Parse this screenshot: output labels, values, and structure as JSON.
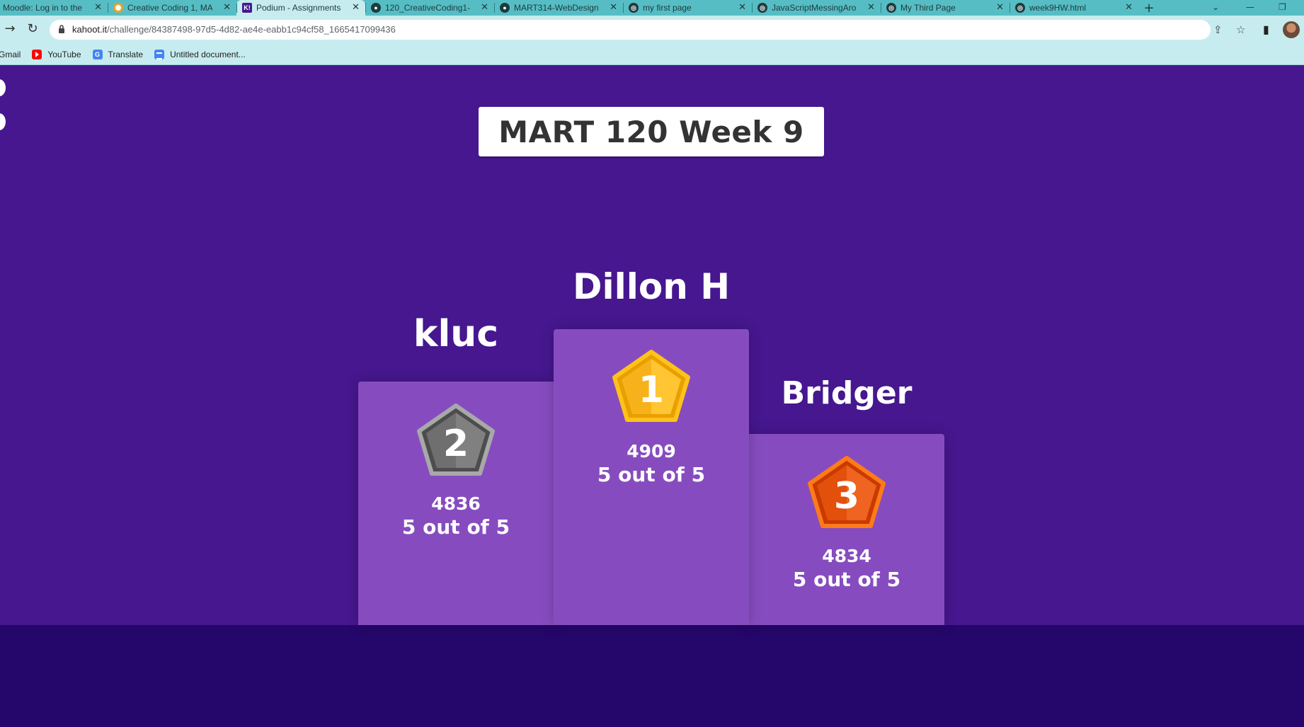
{
  "browser": {
    "tabs": [
      {
        "label": "Moodle: Log in to the",
        "active": false
      },
      {
        "label": "Creative Coding 1, MA",
        "active": false
      },
      {
        "label": "Podium - Assignments",
        "active": true
      },
      {
        "label": "120_CreativeCoding1-",
        "active": false
      },
      {
        "label": "MART314-WebDesign",
        "active": false
      },
      {
        "label": "my first page",
        "active": false
      },
      {
        "label": "JavaScriptMessingAro",
        "active": false
      },
      {
        "label": "My Third Page",
        "active": false
      },
      {
        "label": "week9HW.html",
        "active": false
      }
    ],
    "url_host": "kahoot.it",
    "url_path": "/challenge/84387498-97d5-4d82-ae4e-eabb1c94cf58_1665417099436",
    "bookmarks": [
      {
        "label": "Gmail",
        "icon": "gmail-icon"
      },
      {
        "label": "YouTube",
        "icon": "youtube-icon"
      },
      {
        "label": "Translate",
        "icon": "translate-icon"
      },
      {
        "label": "Untitled document...",
        "icon": "docs-icon"
      }
    ]
  },
  "kahoot": {
    "title": "MART 120 Week 9",
    "colors": {
      "background": "#46178f",
      "footer": "#25076b",
      "pillar": "#864cbf"
    },
    "podium": [
      {
        "rank": "1",
        "name": "Dillon H",
        "score": "4909",
        "correct": "5 out of 5",
        "medal": "gold"
      },
      {
        "rank": "2",
        "name": "kluc",
        "score": "4836",
        "correct": "5 out of 5",
        "medal": "silver"
      },
      {
        "rank": "3",
        "name": "Bridger",
        "score": "4834",
        "correct": "5 out of 5",
        "medal": "bronze"
      }
    ]
  }
}
